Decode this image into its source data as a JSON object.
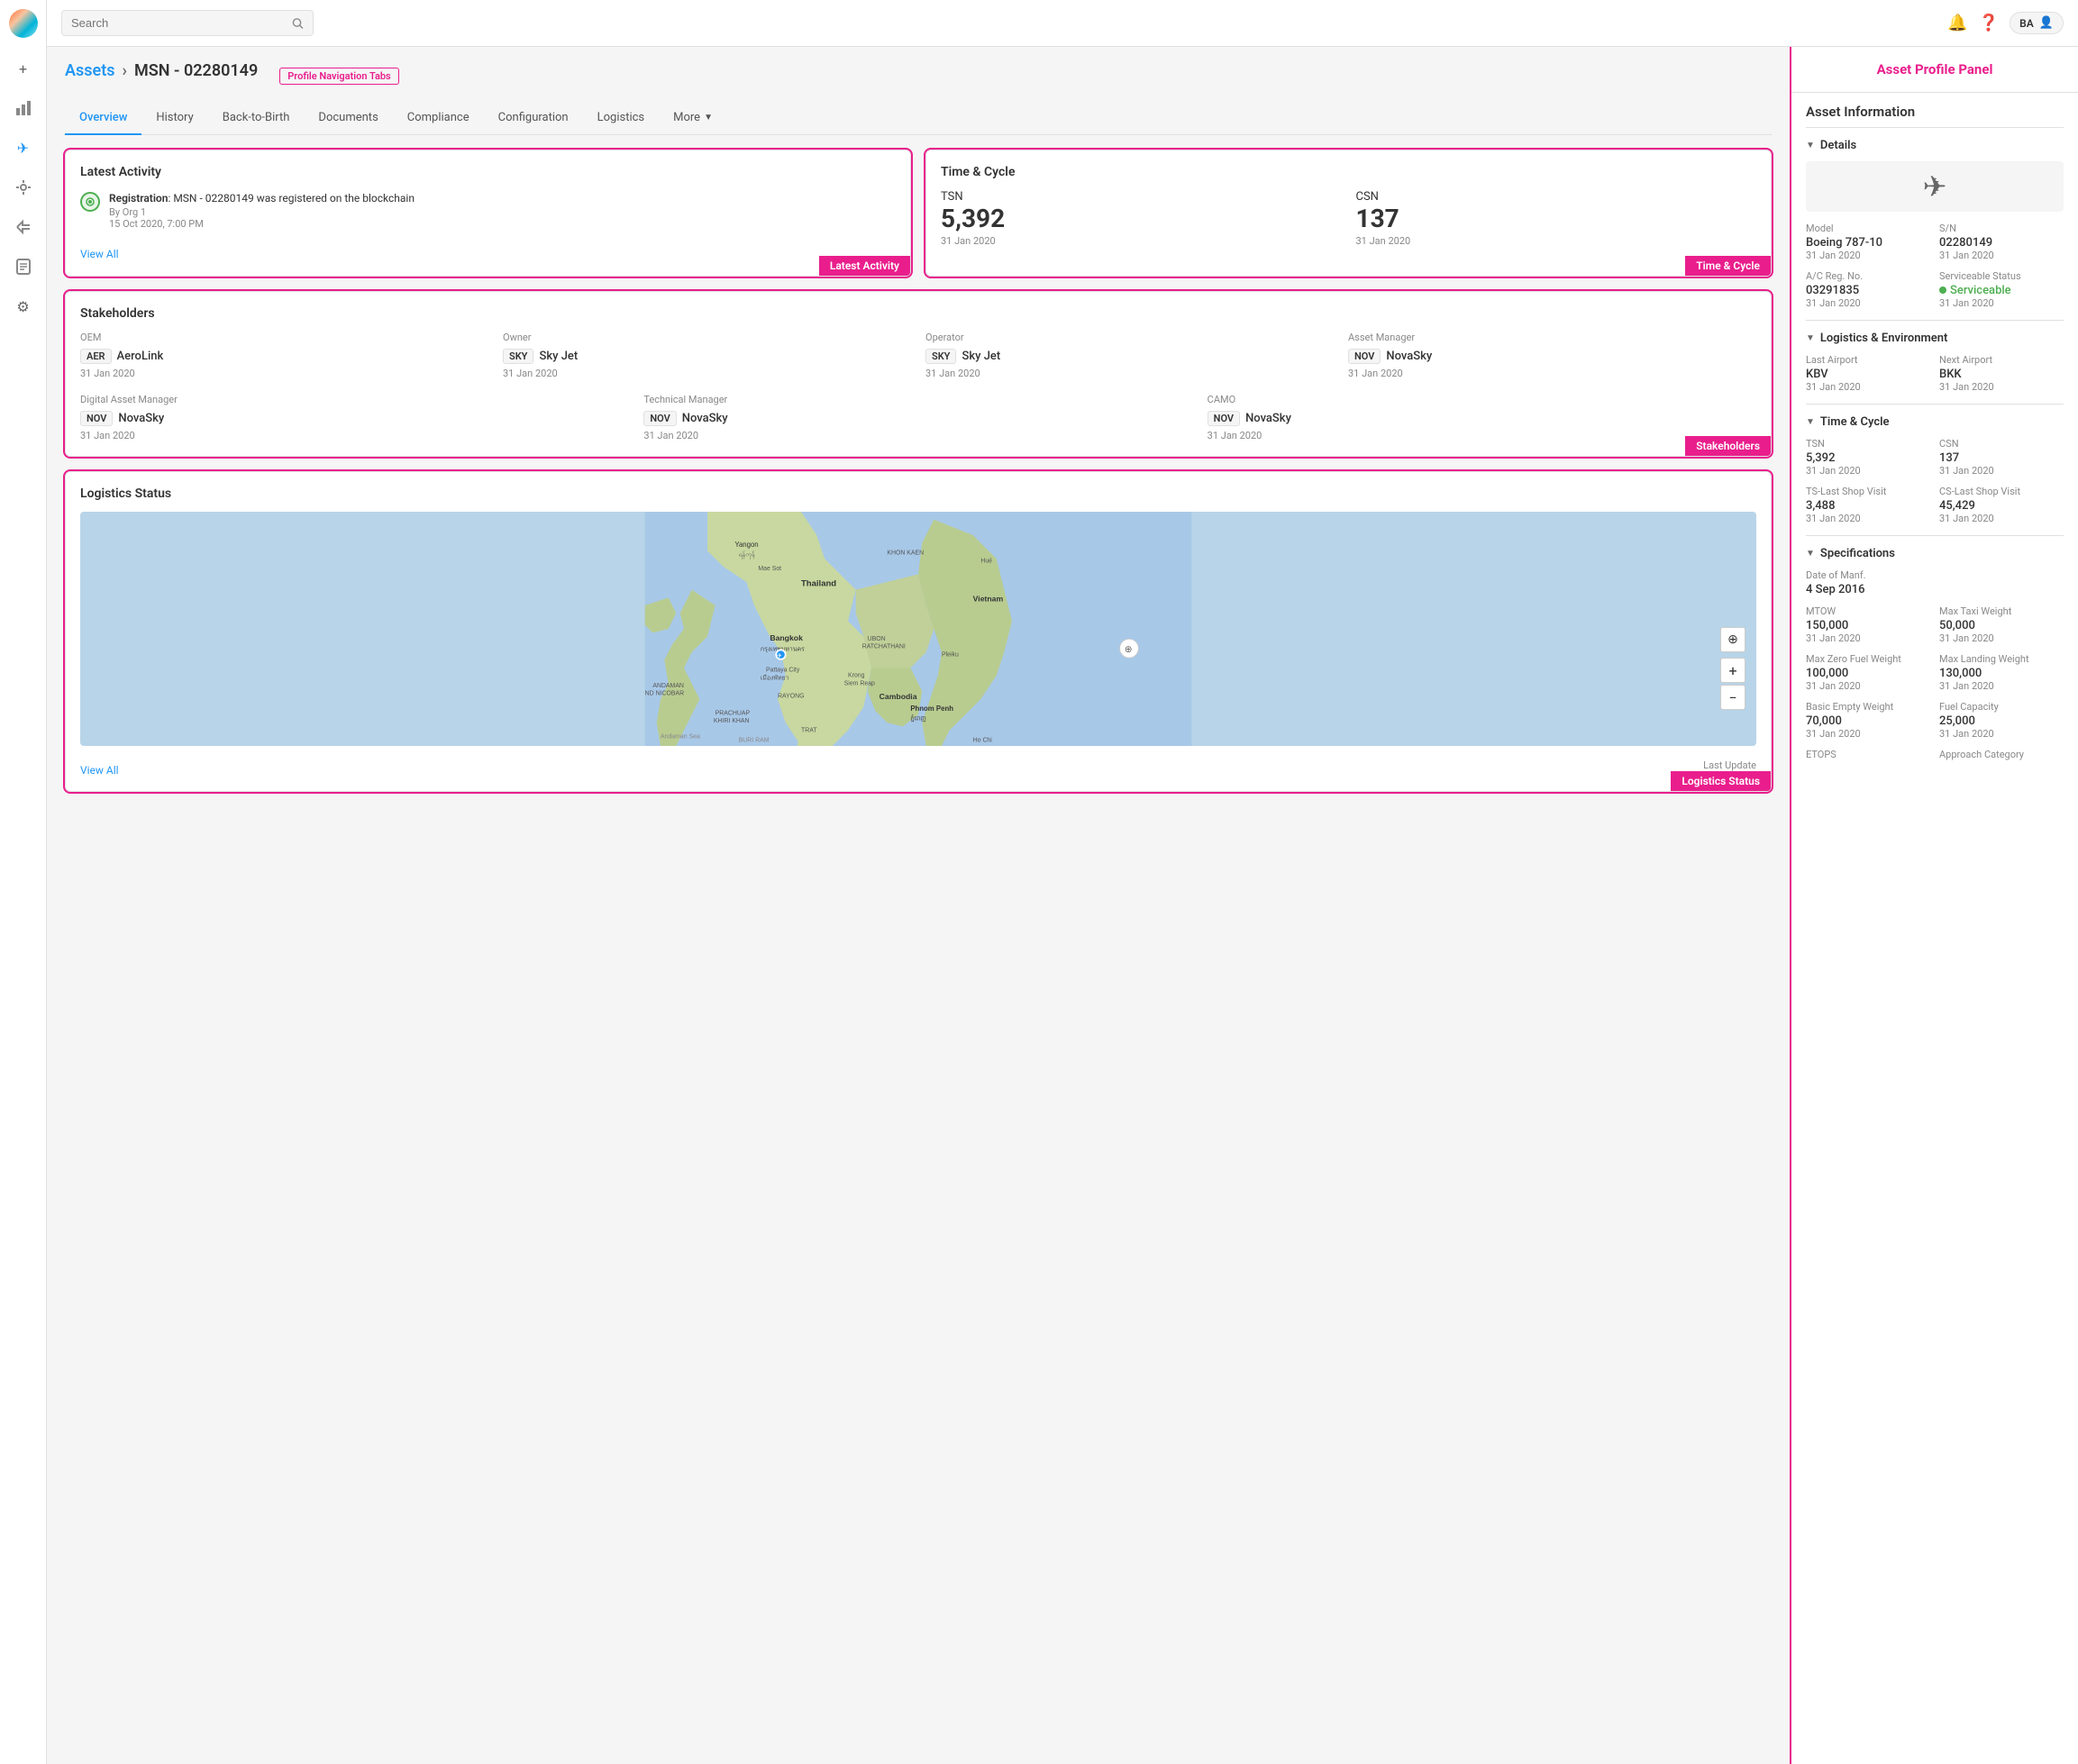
{
  "app": {
    "logo_alt": "App Logo"
  },
  "topbar": {
    "search_placeholder": "Search",
    "notification_icon": "🔔",
    "help_icon": "❓",
    "user_initials": "BA",
    "user_icon": "👤"
  },
  "sidebar": {
    "items": [
      {
        "name": "home",
        "icon": "+",
        "label": "Add"
      },
      {
        "name": "chart",
        "icon": "📊",
        "label": "Analytics"
      },
      {
        "name": "plane",
        "icon": "✈",
        "label": "Assets",
        "active": true
      },
      {
        "name": "wrench",
        "icon": "🔧",
        "label": "Maintenance"
      },
      {
        "name": "flow",
        "icon": "⇌",
        "label": "Workflow"
      },
      {
        "name": "folder",
        "icon": "📁",
        "label": "Documents"
      },
      {
        "name": "settings",
        "icon": "⚙",
        "label": "Settings"
      }
    ]
  },
  "breadcrumb": {
    "link_label": "Assets",
    "separator": "›",
    "current": "MSN - 02280149",
    "profile_nav_label": "Profile Navigation Tabs"
  },
  "tabs": [
    {
      "label": "Overview",
      "active": true
    },
    {
      "label": "History"
    },
    {
      "label": "Back-to-Birth"
    },
    {
      "label": "Documents"
    },
    {
      "label": "Compliance"
    },
    {
      "label": "Configuration"
    },
    {
      "label": "Logistics"
    },
    {
      "label": "More",
      "has_arrow": true
    }
  ],
  "latest_activity": {
    "title": "Latest Activity",
    "card_label": "Latest Activity",
    "item": {
      "type": "Registration",
      "description": "MSN - 02280149 was registered on the blockchain",
      "by": "By Org 1",
      "date": "15 Oct 2020, 7:00 PM"
    },
    "view_all": "View All"
  },
  "time_cycle": {
    "title": "Time & Cycle",
    "card_label": "Time & Cycle",
    "tsn_label": "TSN",
    "tsn_value": "5,392",
    "tsn_date": "31 Jan 2020",
    "csn_label": "CSN",
    "csn_value": "137",
    "csn_date": "31 Jan 2020"
  },
  "stakeholders": {
    "title": "Stakeholders",
    "card_label": "Stakeholders",
    "row1": [
      {
        "role": "OEM",
        "badge": "AER",
        "name": "AeroLink",
        "date": "31 Jan 2020"
      },
      {
        "role": "Owner",
        "badge": "SKY",
        "name": "Sky Jet",
        "date": "31 Jan 2020"
      },
      {
        "role": "Operator",
        "badge": "SKY",
        "name": "Sky Jet",
        "date": "31 Jan 2020"
      },
      {
        "role": "Asset Manager",
        "badge": "NOV",
        "name": "NovaSky",
        "date": "31 Jan 2020"
      }
    ],
    "row2": [
      {
        "role": "Digital Asset Manager",
        "badge": "NOV",
        "name": "NovaSky",
        "date": "31 Jan 2020"
      },
      {
        "role": "Technical Manager",
        "badge": "NOV",
        "name": "NovaSky",
        "date": "31 Jan 2020"
      },
      {
        "role": "CAMO",
        "badge": "NOV",
        "name": "NovaSky",
        "date": "31 Jan 2020"
      }
    ]
  },
  "logistics_status": {
    "title": "Logistics Status",
    "card_label": "Logistics Status",
    "view_all": "View All",
    "last_updated_prefix": "Last Update"
  },
  "asset_profile_panel": {
    "title": "Asset Profile Panel",
    "section_title": "Asset Information",
    "details": {
      "group_label": "Details",
      "aircraft_icon": "✈",
      "model_label": "Model",
      "model_value": "Boeing 787-10",
      "model_date": "31 Jan 2020",
      "sn_label": "S/N",
      "sn_value": "02280149",
      "sn_date": "31 Jan 2020",
      "ac_reg_label": "A/C Reg. No.",
      "ac_reg_value": "03291835",
      "ac_reg_date": "31 Jan 2020",
      "serviceable_label": "Serviceable Status",
      "serviceable_value": "Serviceable",
      "serviceable_date": "31 Jan 2020"
    },
    "logistics_env": {
      "group_label": "Logistics & Environment",
      "last_airport_label": "Last Airport",
      "last_airport_value": "KBV",
      "last_airport_date": "31 Jan 2020",
      "next_airport_label": "Next Airport",
      "next_airport_value": "BKK",
      "next_airport_date": "31 Jan 2020"
    },
    "time_cycle": {
      "group_label": "Time & Cycle",
      "tsn_label": "TSN",
      "tsn_value": "5,392",
      "tsn_date": "31 Jan 2020",
      "csn_label": "CSN",
      "csn_value": "137",
      "csn_date": "31 Jan 2020",
      "ts_shop_label": "TS-Last Shop Visit",
      "ts_shop_value": "3,488",
      "ts_shop_date": "31 Jan 2020",
      "cs_shop_label": "CS-Last Shop Visit",
      "cs_shop_value": "45,429",
      "cs_shop_date": "31 Jan 2020"
    },
    "specifications": {
      "group_label": "Specifications",
      "manf_label": "Date of Manf.",
      "manf_value": "4 Sep 2016",
      "mtow_label": "MTOW",
      "mtow_value": "150,000",
      "mtow_date": "31 Jan 2020",
      "max_taxi_label": "Max Taxi Weight",
      "max_taxi_value": "50,000",
      "max_taxi_date": "31 Jan 2020",
      "max_zfw_label": "Max Zero Fuel Weight",
      "max_zfw_value": "100,000",
      "max_zfw_date": "31 Jan 2020",
      "max_lw_label": "Max Landing Weight",
      "max_lw_value": "130,000",
      "max_lw_date": "31 Jan 2020",
      "bew_label": "Basic Empty Weight",
      "bew_value": "70,000",
      "bew_date": "31 Jan 2020",
      "fuel_capacity_label": "Fuel Capacity",
      "fuel_capacity_value": "25,000",
      "fuel_capacity_date": "31 Jan 2020",
      "etops_label": "ETOPS",
      "approach_label": "Approach Category"
    }
  },
  "colors": {
    "accent": "#e91e8c",
    "primary": "#2196F3",
    "success": "#4caf50"
  }
}
